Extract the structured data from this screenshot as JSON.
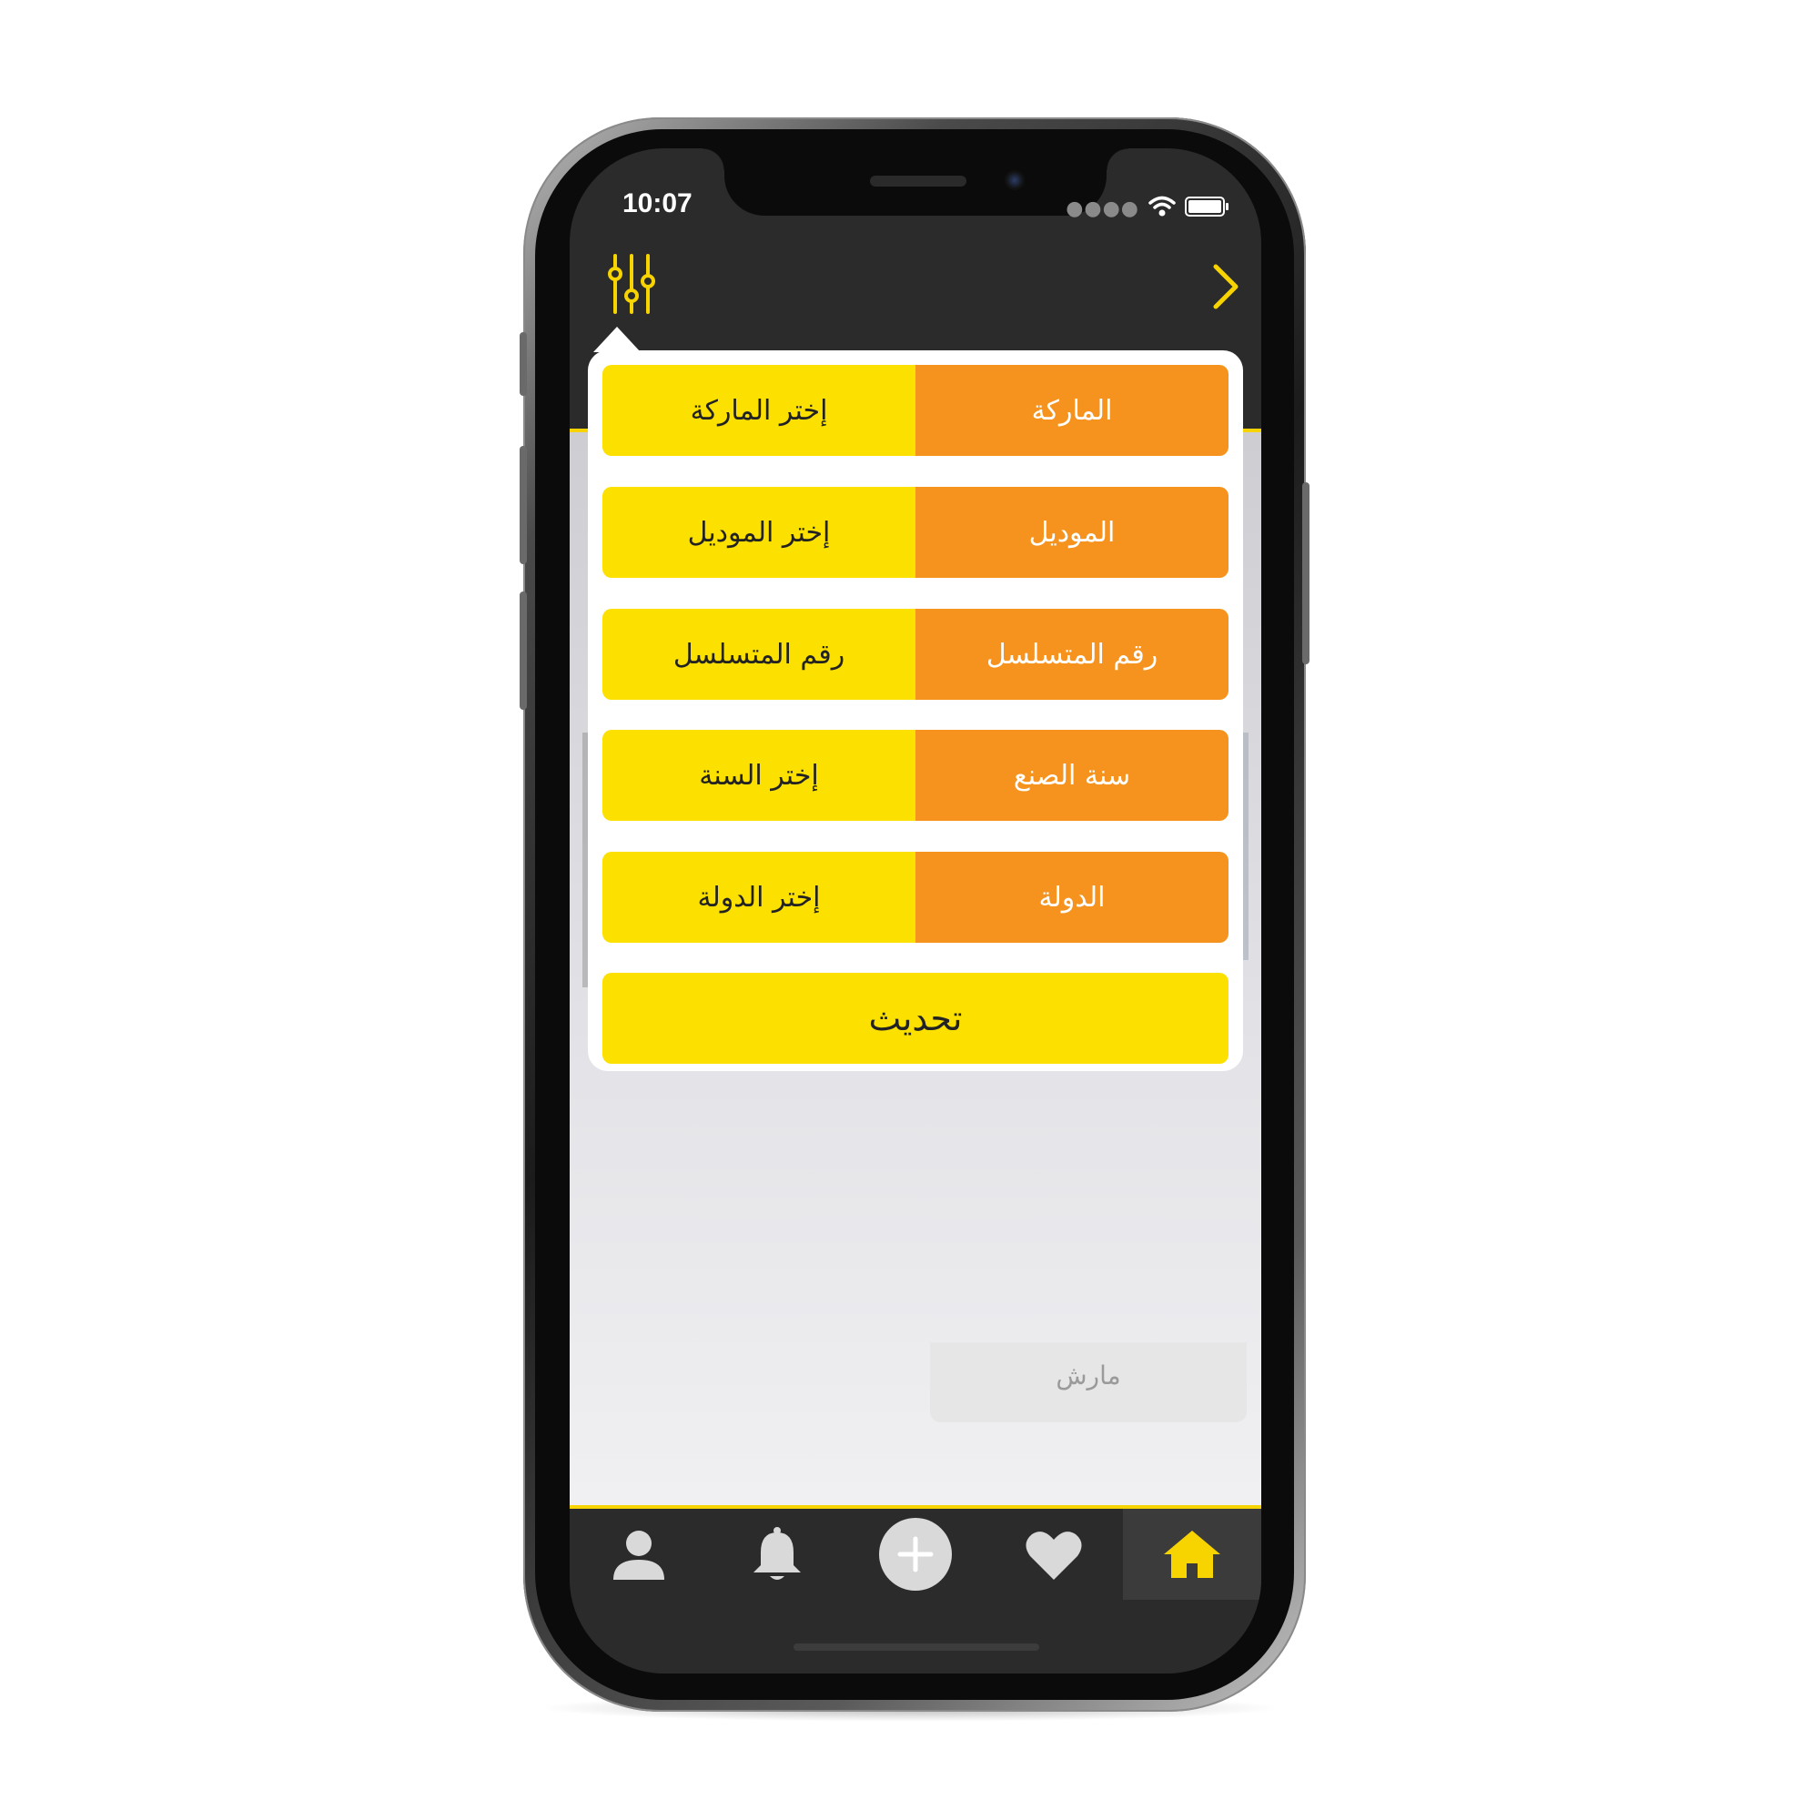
{
  "status_bar": {
    "time": "10:07"
  },
  "header": {
    "filter_icon": "sliders-icon",
    "back_icon": "chevron-right-icon"
  },
  "filter_panel": {
    "rows": [
      {
        "label": "الماركة",
        "value": "إختر الماركة"
      },
      {
        "label": "الموديل",
        "value": "إختر الموديل"
      },
      {
        "label": "رقم المتسلسل",
        "value": "رقم المتسلسل"
      },
      {
        "label": "سنة الصنع",
        "value": "إختر السنة"
      },
      {
        "label": "الدولة",
        "value": "إختر الدولة"
      }
    ],
    "update_label": "تحديث"
  },
  "background": {
    "date_text": "مارش"
  },
  "tab_bar": {
    "tabs": [
      {
        "icon": "user-icon"
      },
      {
        "icon": "bell-icon"
      },
      {
        "icon": "plus-circle-icon"
      },
      {
        "icon": "heart-icon"
      },
      {
        "icon": "home-icon",
        "active": true
      }
    ]
  },
  "colors": {
    "accent_yellow": "#fce100",
    "label_orange": "#f5931e",
    "dark_bar": "#2b2b2b",
    "icon_gray": "#d9d9d9"
  }
}
